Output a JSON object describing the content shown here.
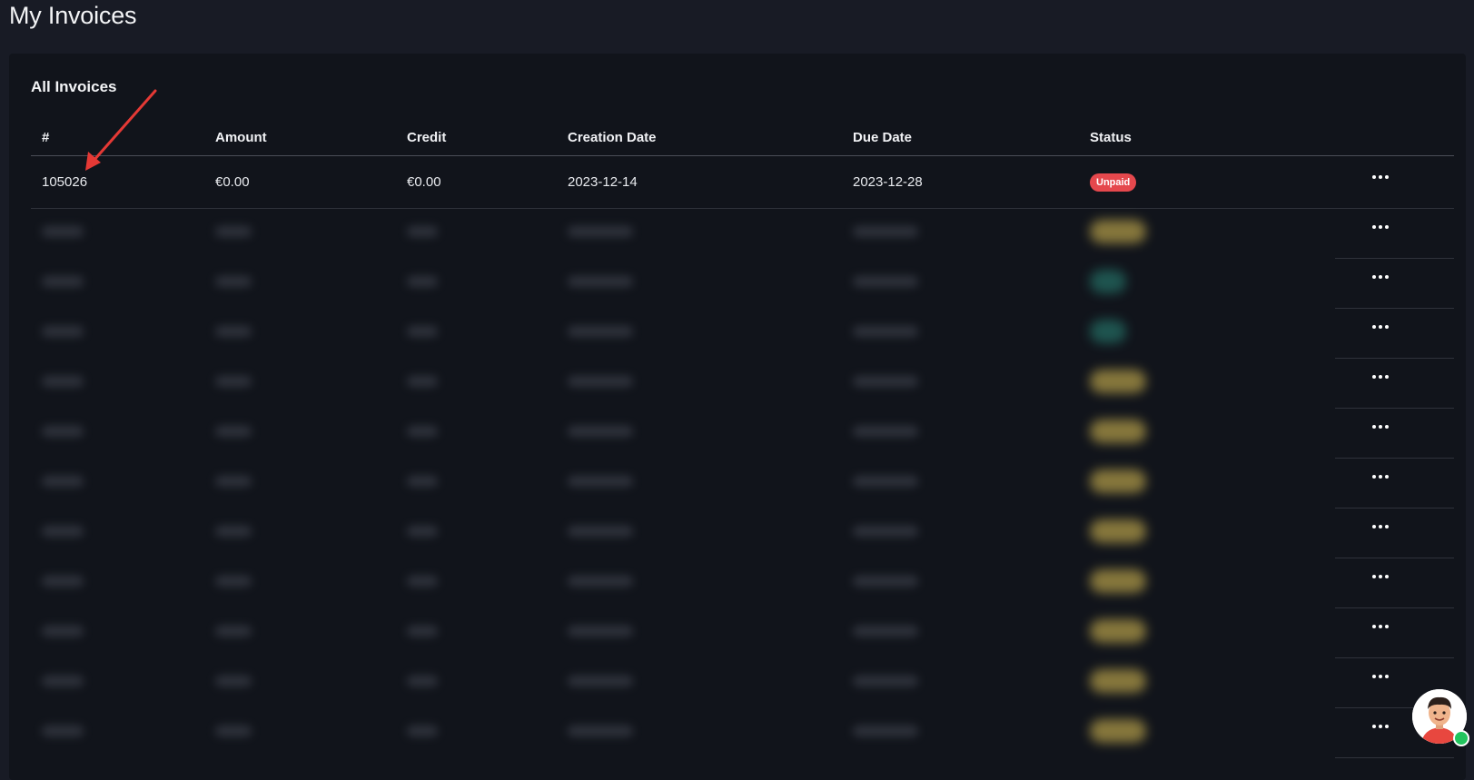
{
  "page": {
    "title": "My Invoices"
  },
  "card": {
    "title": "All Invoices"
  },
  "columns": [
    "#",
    "Amount",
    "Credit",
    "Creation Date",
    "Due Date",
    "Status"
  ],
  "first_row": {
    "number": "105026",
    "amount": "€0.00",
    "credit": "€0.00",
    "creation_date": "2023-12-14",
    "due_date": "2023-12-28",
    "status": "Unpaid"
  },
  "blurred_rows": [
    {
      "status_color": "#b8a14a"
    },
    {
      "status_color": "#2a8a7b"
    },
    {
      "status_color": "#2a8a7b"
    },
    {
      "status_color": "#b8a14a"
    },
    {
      "status_color": "#b8a14a"
    },
    {
      "status_color": "#b8a14a"
    },
    {
      "status_color": "#b8a14a"
    },
    {
      "status_color": "#b8a14a"
    },
    {
      "status_color": "#b8a14a"
    },
    {
      "status_color": "#b8a14a"
    },
    {
      "status_color": "#b8a14a"
    }
  ],
  "colors": {
    "page_bg": "#181b25",
    "card_bg": "#11141b",
    "unpaid_badge": "#e5484d",
    "annotation_arrow": "#e53935",
    "online_indicator": "#22c55e"
  },
  "icons": {
    "row_actions": "more-horizontal-icon",
    "support_avatar": "support-avatar-icon"
  }
}
